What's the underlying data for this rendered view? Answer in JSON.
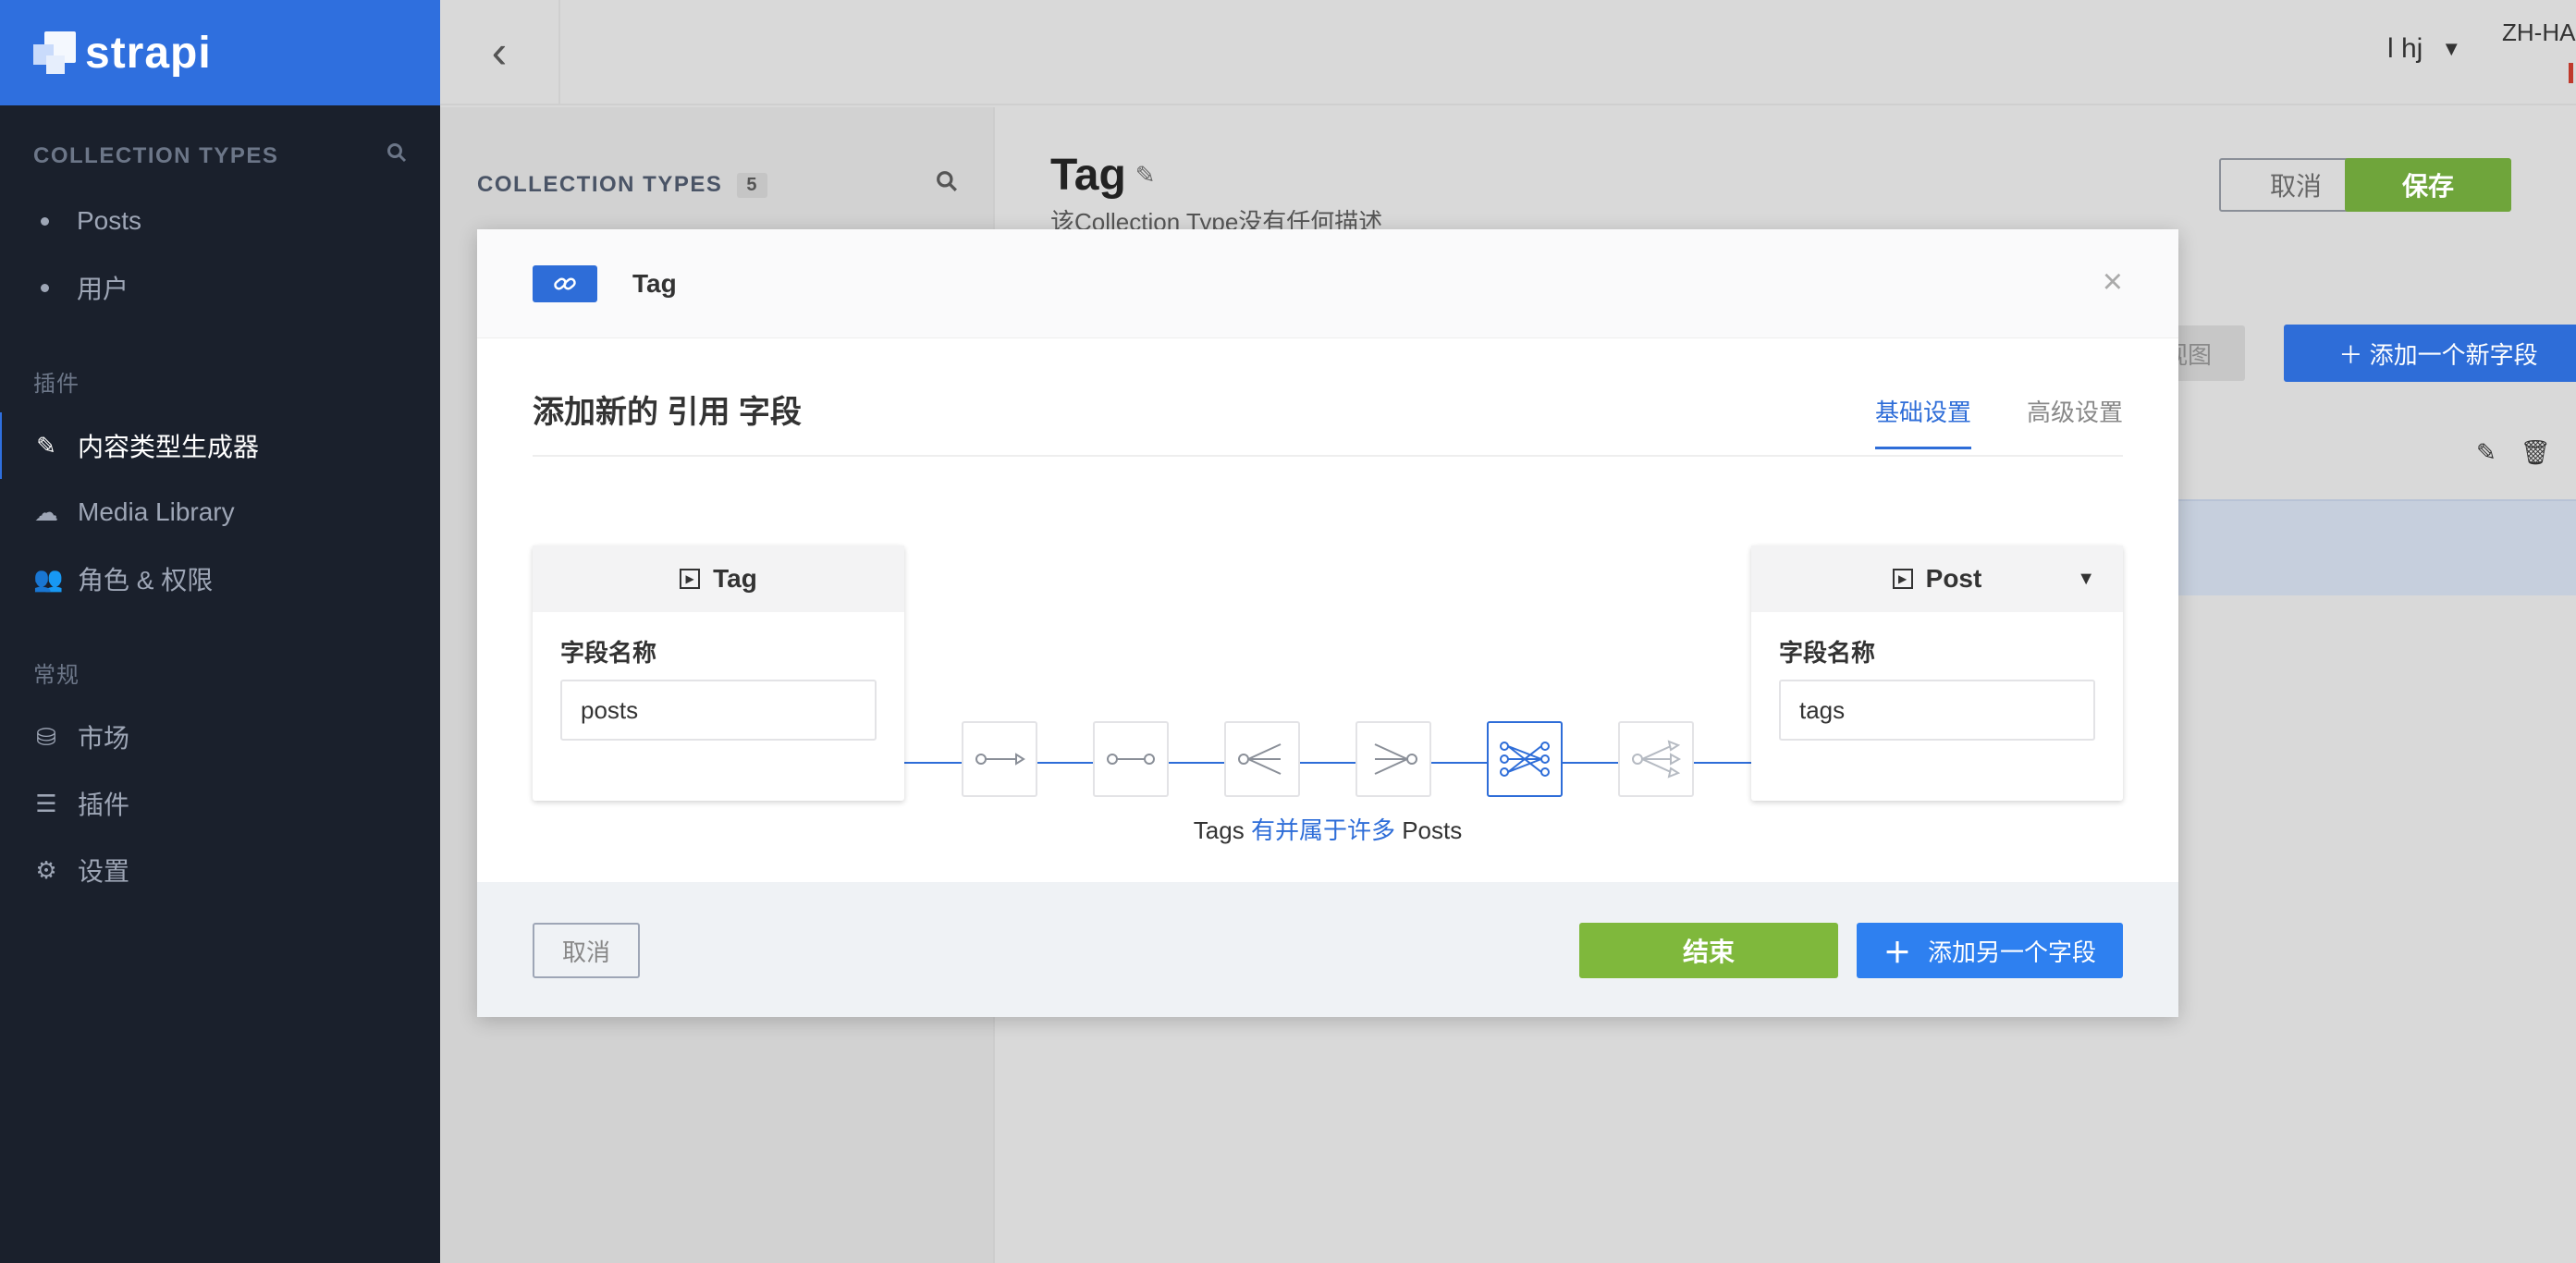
{
  "brand": {
    "name": "strapi"
  },
  "sidebar": {
    "collection_header": "COLLECTION TYPES",
    "collection_items": [
      "Posts",
      "用户"
    ],
    "plugins_header": "插件",
    "plugin_items": [
      {
        "label": "内容类型生成器",
        "icon": "brush-icon",
        "active": true
      },
      {
        "label": "Media Library",
        "icon": "cloud-upload-icon"
      },
      {
        "label": "角色 & 权限",
        "icon": "users-icon"
      }
    ],
    "general_header": "常规",
    "general_items": [
      {
        "label": "市场",
        "icon": "basket-icon"
      },
      {
        "label": "插件",
        "icon": "list-icon"
      },
      {
        "label": "设置",
        "icon": "gear-icon"
      }
    ]
  },
  "topbar": {
    "user": "l hj",
    "language": "ZH-HA"
  },
  "midcol": {
    "title": "COLLECTION TYPES",
    "count": "5"
  },
  "main": {
    "title": "Tag",
    "description": "该Collection Type没有任何描述",
    "cancel": "取消",
    "save": "保存",
    "view_button": "置视图",
    "add_field": "添加一个新字段"
  },
  "modal": {
    "badge_icon": "link-icon",
    "title": "Tag",
    "heading": "添加新的 引用 字段",
    "tabs": {
      "basic": "基础设置",
      "advanced": "高级设置"
    },
    "left_card": {
      "title": "Tag",
      "field_label": "字段名称",
      "value": "posts"
    },
    "right_card": {
      "title": "Post",
      "field_label": "字段名称",
      "value": "tags"
    },
    "relation_caption": {
      "left": "Tags",
      "middle": "有并属于许多",
      "right": "Posts"
    },
    "footer": {
      "cancel": "取消",
      "finish": "结束",
      "add_another": "添加另一个字段"
    }
  },
  "colors": {
    "primary": "#2e6dd8",
    "success": "#7fb83c",
    "sidebar": "#1a202c",
    "brand": "#2f6fde"
  }
}
